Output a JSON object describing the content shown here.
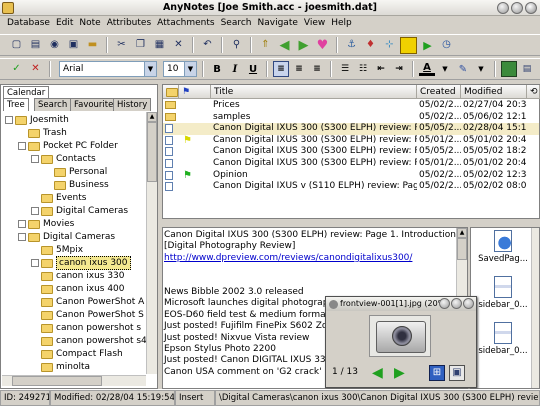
{
  "window": {
    "title": "AnyNotes [Joe Smith.acc - joesmith.dat]"
  },
  "menu": [
    "Database",
    "Edit",
    "Note",
    "Attributes",
    "Attachments",
    "Search",
    "Navigate",
    "View",
    "Help"
  ],
  "format": {
    "font": "Arial",
    "size": "10"
  },
  "left": {
    "calendar_tab": "Calendar",
    "tabs": [
      "Tree",
      "Search",
      "Favourites",
      "History"
    ],
    "tree": [
      {
        "label": "Joesmith",
        "indent": 0,
        "exp": "-"
      },
      {
        "label": "Trash",
        "indent": 1,
        "exp": ""
      },
      {
        "label": "Pocket PC Folder",
        "indent": 1,
        "exp": "-"
      },
      {
        "label": "Contacts",
        "indent": 2,
        "exp": "-"
      },
      {
        "label": "Personal",
        "indent": 3,
        "exp": ""
      },
      {
        "label": "Business",
        "indent": 3,
        "exp": ""
      },
      {
        "label": "Events",
        "indent": 2,
        "exp": ""
      },
      {
        "label": "Digital Cameras",
        "indent": 2,
        "exp": "+"
      },
      {
        "label": "Movies",
        "indent": 1,
        "exp": "+"
      },
      {
        "label": "Digital Cameras",
        "indent": 1,
        "exp": "-"
      },
      {
        "label": "5Mpix",
        "indent": 2,
        "exp": ""
      },
      {
        "label": "canon ixus 300",
        "indent": 2,
        "exp": "+",
        "selected": true
      },
      {
        "label": "canon ixus 330",
        "indent": 2,
        "exp": ""
      },
      {
        "label": "canon ixus 400",
        "indent": 2,
        "exp": ""
      },
      {
        "label": "Canon PowerShot A",
        "indent": 2,
        "exp": ""
      },
      {
        "label": "Canon PowerShot S",
        "indent": 2,
        "exp": ""
      },
      {
        "label": "canon powershot s",
        "indent": 2,
        "exp": ""
      },
      {
        "label": "canon powershot s4",
        "indent": 2,
        "exp": ""
      },
      {
        "label": "Compact Flash",
        "indent": 2,
        "exp": ""
      },
      {
        "label": "minolta",
        "indent": 2,
        "exp": ""
      }
    ]
  },
  "list": {
    "columns": {
      "title": "Title",
      "created": "Created",
      "modified": "Modified"
    },
    "rows": [
      {
        "title": "Prices",
        "created": "05/02/2...",
        "modified": "02/27/04 20:34:...",
        "icon": "folder"
      },
      {
        "title": "samples",
        "created": "05/02/2...",
        "modified": "05/06/02 12:18:...",
        "icon": "folder"
      },
      {
        "title": "Canon Digital IXUS 300 (S300 ELPH) review: Pa...",
        "created": "05/05/2...",
        "modified": "02/28/04 15:19:...",
        "icon": "note",
        "selected": true
      },
      {
        "title": "Canon Digital IXUS 300 (S300 ELPH) review: Pa...",
        "created": "05/01/2...",
        "modified": "05/01/02 20:48:...",
        "icon": "note",
        "flag": "#d8d800"
      },
      {
        "title": "Canon Digital IXUS 300 (S300 ELPH) review: Pa...",
        "created": "05/05/2...",
        "modified": "05/05/02 18:24:...",
        "icon": "note"
      },
      {
        "title": "Canon Digital IXUS 300 (S300 ELPH) review: Pa...",
        "created": "05/01/2...",
        "modified": "05/01/02 20:47:...",
        "icon": "note"
      },
      {
        "title": "Opinion",
        "created": "05/02/2...",
        "modified": "05/02/02 12:34:...",
        "icon": "note",
        "flag": "#20b020"
      },
      {
        "title": "Canon Digital IXUS v (S110 ELPH) review: Page ...",
        "created": "05/02/2...",
        "modified": "05/02/02 08:07:...",
        "icon": "note"
      }
    ]
  },
  "note": {
    "lines": [
      "Canon Digital IXUS 300 (S300 ELPH) review: Page 1. Introduction",
      "[Digital Photography Review]",
      "http://www.dpreview.com/reviews/canondigitalixus300/",
      "",
      "",
      "  News Bibble 2002 3.0 released",
      "Microsoft launches digital photography",
      "EOS-D60 field test & medium format co",
      "Just posted! Fujifilm FinePix S602 Zoor",
      "Just posted! Nixvue Vista review",
      "Epson Stylus Photo 2200",
      "Just posted! Canon DIGITAL IXUS 330",
      "Canon USA comment on 'G2 crack' repo"
    ]
  },
  "attachments": [
    {
      "label": "SavedPag..."
    },
    {
      "label": "sidebar_0..."
    },
    {
      "label": "sidebar_0..."
    }
  ],
  "viewer": {
    "title": "frontview-001[1].jpg (20%)",
    "counter": "1 / 13"
  },
  "status": {
    "id": "ID: 24927124",
    "modified": "Modified: 02/28/04 15:19:54",
    "mode": "Insert",
    "path": "\\Digital Cameras\\canon ixus 300\\Canon Digital IXUS 300 (S300 ELPH) review: Page 1. Intro"
  }
}
